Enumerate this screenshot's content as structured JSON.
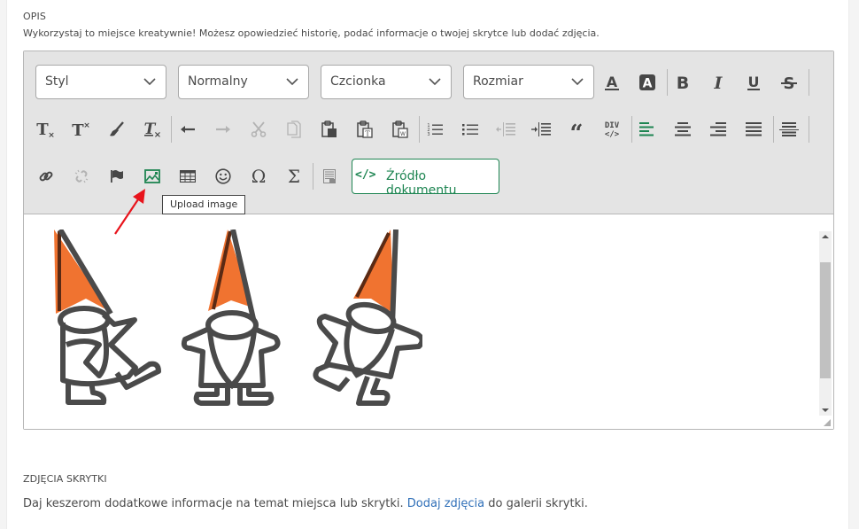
{
  "description_section": {
    "label": "OPIS",
    "hint": "Wykorzystaj to miejsce kreatywnie! Możesz opowiedzieć historię, podać informacje o twojej skrytce lub dodać zdjęcia."
  },
  "toolbar": {
    "combos": [
      {
        "name": "style",
        "label": "Styl"
      },
      {
        "name": "format",
        "label": "Normalny"
      },
      {
        "name": "font",
        "label": "Czcionka"
      },
      {
        "name": "size",
        "label": "Rozmiar"
      }
    ],
    "row1_icons": [
      "text-color-icon",
      "background-color-icon",
      "bold-icon",
      "italic-icon",
      "underline-icon",
      "strikethrough-icon"
    ],
    "row2_icons": [
      "subscript-icon",
      "superscript-icon",
      "copy-formatting-icon",
      "remove-format-icon",
      "undo-icon",
      "redo-icon",
      "cut-icon",
      "copy-icon",
      "paste-icon",
      "paste-text-icon",
      "paste-from-word-icon",
      "numbered-list-icon",
      "bulleted-list-icon",
      "decrease-indent-icon",
      "increase-indent-icon",
      "blockquote-icon",
      "div-container-icon",
      "align-left-icon",
      "align-center-icon",
      "align-right-icon",
      "justify-icon",
      "horizontal-line-icon"
    ],
    "row3_icons": [
      "link-icon",
      "unlink-icon",
      "anchor-icon",
      "upload-image-icon",
      "table-icon",
      "emoji-icon",
      "special-char-icon",
      "math-icon",
      "templates-icon"
    ],
    "code_glyph": "</>",
    "source_button_label": "Źródło dokumentu",
    "tooltip": "Upload image",
    "accent_color": "#1e8552"
  },
  "content": {
    "image_alt": "Three dancing gnomes with orange hats",
    "hat_color": "#f07330",
    "outline_color": "#4a4a4a"
  },
  "photos_section": {
    "label": "ZDJĘCIA SKRYTKI",
    "text_before": "Daj keszerom dodatkowe informacje na temat miejsca lub skrytki.",
    "link_text": "Dodaj zdjęcia",
    "text_after": "do galerii skrytki."
  }
}
